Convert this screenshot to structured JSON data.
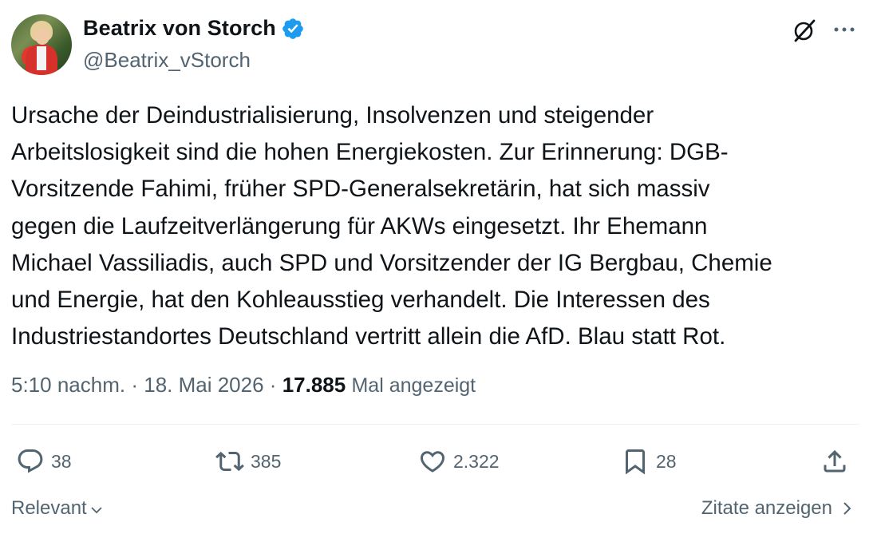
{
  "author": {
    "name": "Beatrix von Storch",
    "handle": "@Beatrix_vStorch",
    "verified": true
  },
  "tweet": {
    "text": "Ursache der Deindustrialisierung, Insolvenzen und steigender\nArbeitslosigkeit sind die hohen Energiekosten. Zur Erinnerung: DGB-\nVorsitzende Fahimi, früher SPD-Generalsekretärin, hat sich massiv\ngegen die Laufzeitverlängerung für AKWs eingesetzt. Ihr Ehemann\nMichael Vassiliadis, auch SPD und Vorsitzender der IG Bergbau, Chemie\nund Energie, hat den Kohleausstieg verhandelt. Die Interessen des\nIndustriestandortes Deutschland vertritt allein die AfD. Blau statt Rot."
  },
  "meta": {
    "time": "5:10 nachm.",
    "sep1": "·",
    "date": "18. Mai 2026",
    "sep2": "·",
    "views": "17.885",
    "views_label": "Mal angezeigt"
  },
  "actions": {
    "replies": "38",
    "retweets": "385",
    "likes": "2.322",
    "bookmarks": "28"
  },
  "footer": {
    "sort_label": "Relevant",
    "quotes_label": "Zitate anzeigen"
  },
  "icons": [
    "grok-icon",
    "more-icon",
    "verified-badge-icon",
    "reply-icon",
    "retweet-icon",
    "like-icon",
    "bookmark-icon",
    "share-icon",
    "chevron-down-icon",
    "chevron-right-icon"
  ],
  "colors": {
    "text": "#0f1419",
    "secondary": "#536471",
    "verified": "#1d9bf0",
    "divider": "#eff3f4"
  }
}
